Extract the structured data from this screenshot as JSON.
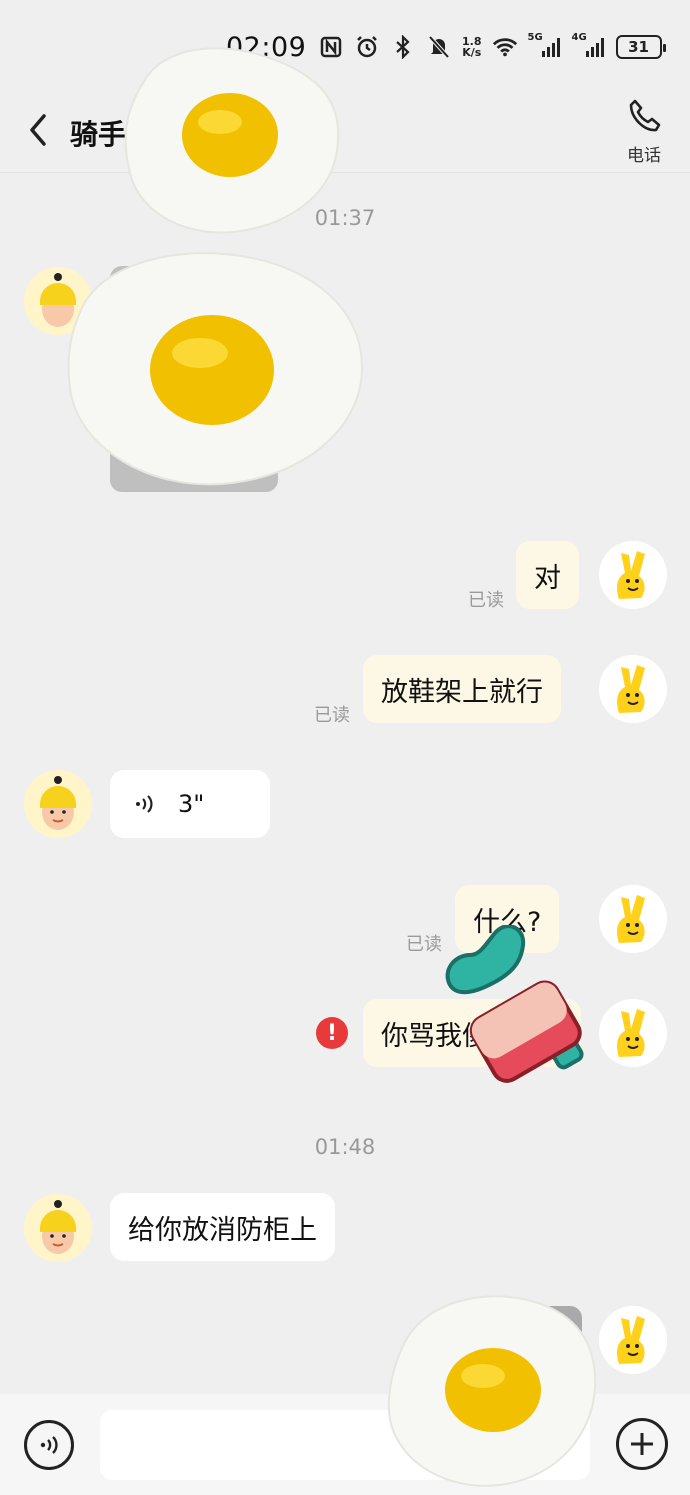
{
  "status_bar": {
    "time": "02:09",
    "net_speed_value": "1.8",
    "net_speed_unit": "K/s",
    "sig1": "5G",
    "sig2": "4G",
    "battery": "31"
  },
  "header": {
    "back_icon": "chevron-left-icon",
    "title": "骑手",
    "call_label": "电话"
  },
  "messages": {
    "ts1": "01:37",
    "m1": "对",
    "m1_read": "已读",
    "m2": "放鞋架上就行",
    "m2_read": "已读",
    "m3_duration": "3\"",
    "m4": "什么?",
    "m4_read": "已读",
    "m5": "你骂我傻",
    "ts2": "01:48",
    "m6": "给你放消防柜上"
  },
  "input": {
    "placeholder": ""
  },
  "colors": {
    "bg": "#efefef",
    "out_bubble": "#fdf8e6",
    "error": "#e8393b",
    "egg_yolk": "#f1c000"
  }
}
